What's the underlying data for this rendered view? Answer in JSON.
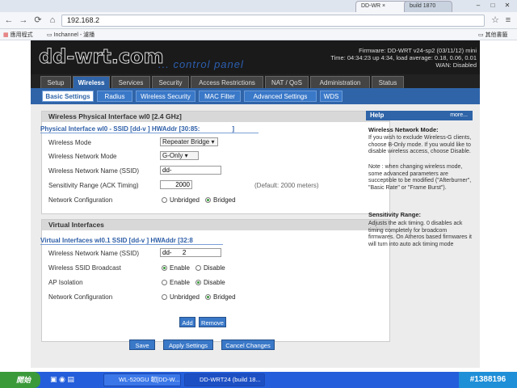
{
  "browser": {
    "tabs": [
      {
        "label": "DD-WR"
      },
      {
        "label": "build 1870"
      }
    ],
    "url": "192.168.2",
    "bookmarks": [
      "應用程式",
      "Inchannel - 濾播"
    ],
    "other_bookmarks": "其他書籤"
  },
  "header": {
    "logo": "dd-wrt.com",
    "tagline": "... control panel",
    "firmware": "Firmware: DD-WRT v24-sp2 (03/11/12) mini",
    "time": "Time: 04:34:23 up 4:34, load average: 0.18, 0.06, 0.01",
    "wan": "WAN: Disabled"
  },
  "main_tabs": [
    "Setup",
    "Wireless",
    "Services",
    "Security",
    "Access Restrictions",
    "NAT / QoS",
    "Administration",
    "Status"
  ],
  "sub_tabs": [
    "Basic Settings",
    "Radius",
    "Wireless Security",
    "MAC Filter",
    "Advanced Settings",
    "WDS"
  ],
  "physical": {
    "section_title": "Wireless Physical Interface wl0 [2.4 GHz]",
    "iface_label": "Physical Interface wl0 - SSID [dd-v",
    "hwaddr": "] HWAddr [30:85:",
    "hwaddr_end": "]",
    "mode_label": "Wireless Mode",
    "mode_value": "Repeater Bridge",
    "netmode_label": "Wireless Network Mode",
    "netmode_value": "G-Only",
    "ssid_label": "Wireless Network Name (SSID)",
    "ssid_value": "dd-",
    "sens_label": "Sensitivity Range (ACK Timing)",
    "sens_value": "2000",
    "sens_default": "(Default: 2000 meters)",
    "netcfg_label": "Network Configuration",
    "opt_unbridged": "Unbridged",
    "opt_bridged": "Bridged"
  },
  "virtual": {
    "section_title": "Virtual Interfaces",
    "iface_label": "Virtual Interfaces wl0.1 SSID [dd-v",
    "hwaddr": "] HWAddr [32:8",
    "ssid_label": "Wireless Network Name (SSID)",
    "ssid_value": "dd-      2",
    "broadcast_label": "Wireless SSID Broadcast",
    "opt_enable": "Enable",
    "opt_disable": "Disable",
    "ap_label": "AP Isolation",
    "netcfg_label": "Network Configuration",
    "opt_unbridged": "Unbridged",
    "opt_bridged": "Bridged"
  },
  "buttons": {
    "add": "Add",
    "remove": "Remove",
    "save": "Save",
    "apply": "Apply Settings",
    "cancel": "Cancel Changes"
  },
  "help": {
    "title": "Help",
    "more": "more...",
    "t1": "Wireless Network Mode:",
    "p1": "If you wish to exclude Wireless-G clients, choose B-Only mode. If you would like to disable wireless access, choose Disable.",
    "note": "Note : when changing wireless mode, some advanced parameters are succeptible to be modified (\"Afterburner\", \"Basic Rate\" or \"Frame Burst\").",
    "t2": "Sensitivity Range:",
    "p2": "Adjusts the ack timing. 0 disables ack timing completely for broadcom firmwares. On Atheros based firmwares it will turn into auto ack timing mode"
  },
  "taskbar": {
    "start": "開始",
    "tasks": [
      "WL-520GU 韌[DD-W...",
      "DD-WRT24 (build 18..."
    ],
    "tray": "#1388196"
  }
}
